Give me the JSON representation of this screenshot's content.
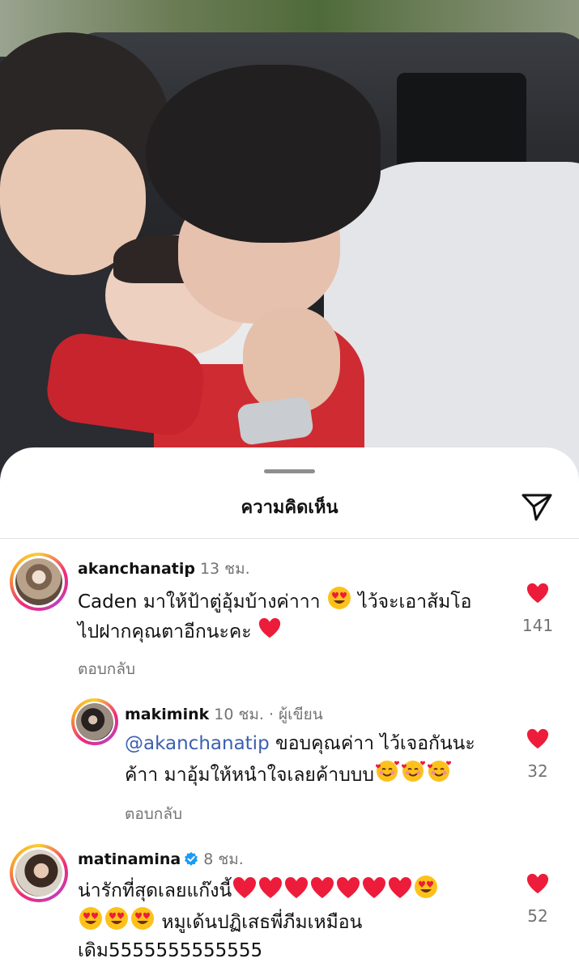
{
  "sheet": {
    "title": "ความคิดเห็น"
  },
  "colors": {
    "heart": "#ed1c3b",
    "mention": "#3b5fb0",
    "muted": "#737373",
    "verified": "#1d9bf0"
  },
  "comments": [
    {
      "username": "akanchanatip",
      "time": "13 ชม.",
      "text_line1": "Caden มาให้ป้าตู่อุ้มบ้างค่าาา",
      "text_line1_after": "ไว้จะเอาส้มโอ",
      "text_line2": "ไปฝากคุณตาอีกนะคะ",
      "emojis": [
        "smiling-face-heart-eyes",
        "red-heart"
      ],
      "reply_label": "ตอบกลับ",
      "like_count": "141"
    },
    {
      "username": "makimink",
      "time": "10 ชม.",
      "tag": "· ผู้เขียน",
      "mention": "@akanchanatip",
      "text_line1": "ขอบคุณค่าา ไว้เจอกันนะ",
      "text_line2": "ค้าา มาอุ้มให้หนำใจเลยค้าบบบ",
      "emojis": [
        "smiling-face-with-hearts",
        "smiling-face-with-hearts",
        "smiling-face-with-hearts"
      ],
      "reply_label": "ตอบกลับ",
      "like_count": "32"
    },
    {
      "username": "matinamina",
      "verified": true,
      "time": "8 ชม.",
      "text_line1": "น่ารักที่สุดเลยแก๊งนี้",
      "text_line2_after": "หมูเด้นปฏิเสธพี่ภีมเหมือน",
      "text_line3": "เดิม5555555555555",
      "emojis": [
        "red-heart",
        "red-heart",
        "red-heart",
        "red-heart",
        "red-heart",
        "red-heart",
        "red-heart",
        "smiling-face-heart-eyes",
        "smiling-face-heart-eyes",
        "smiling-face-heart-eyes",
        "smiling-face-heart-eyes"
      ],
      "like_count": "52"
    }
  ]
}
